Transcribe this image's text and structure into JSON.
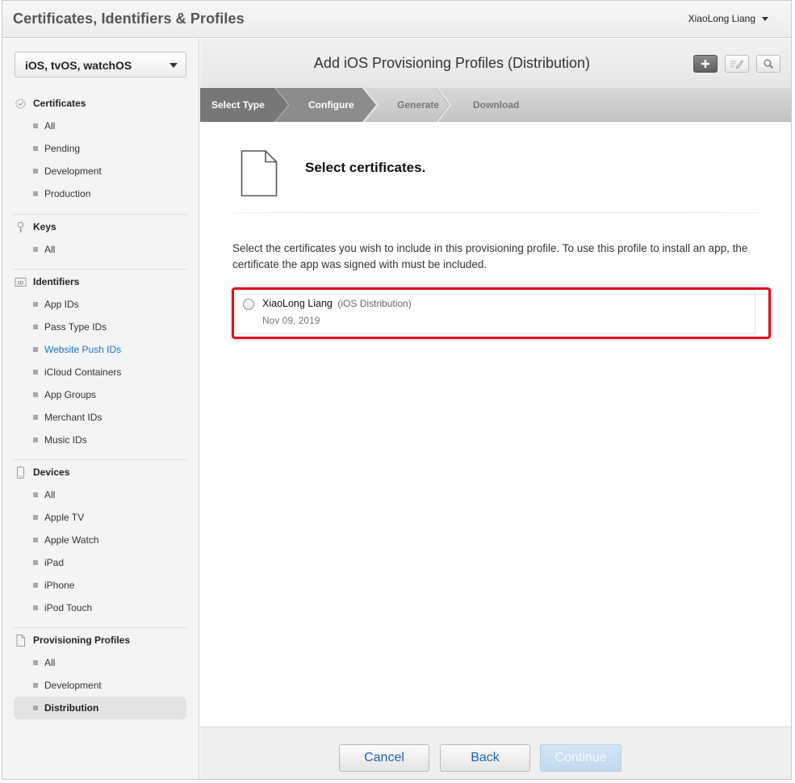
{
  "app": {
    "title": "Certificates, Identifiers & Profiles",
    "user_name": "XiaoLong Liang"
  },
  "sidebar": {
    "platform": "iOS, tvOS, watchOS",
    "sections": [
      {
        "title": "Certificates",
        "icon": "certificate-icon",
        "items": [
          "All",
          "Pending",
          "Development",
          "Production"
        ]
      },
      {
        "title": "Keys",
        "icon": "key-icon",
        "items": [
          "All"
        ]
      },
      {
        "title": "Identifiers",
        "icon": "id-icon",
        "items": [
          "App IDs",
          "Pass Type IDs",
          "Website Push IDs",
          "iCloud Containers",
          "App Groups",
          "Merchant IDs",
          "Music IDs"
        ]
      },
      {
        "title": "Devices",
        "icon": "device-icon",
        "items": [
          "All",
          "Apple TV",
          "Apple Watch",
          "iPad",
          "iPhone",
          "iPod Touch"
        ]
      },
      {
        "title": "Provisioning Profiles",
        "icon": "document-icon",
        "items": [
          "All",
          "Development",
          "Distribution"
        ]
      }
    ],
    "highlighted_link": "Website Push IDs",
    "active_item": "Distribution"
  },
  "main": {
    "title": "Add iOS Provisioning Profiles (Distribution)",
    "toolbar_icons": [
      "plus-icon",
      "edit-icon",
      "search-icon"
    ],
    "steps": [
      "Select Type",
      "Configure",
      "Generate",
      "Download"
    ],
    "content_title": "Select certificates.",
    "description": "Select the certificates you wish to include in this provisioning profile. To use this profile to install an app, the certificate the app was signed with must be included.",
    "certificate": {
      "name": "XiaoLong Liang",
      "type": "(iOS Distribution)",
      "date": "Nov 09, 2019",
      "selected": false
    }
  },
  "footer": {
    "cancel_label": "Cancel",
    "back_label": "Back",
    "continue_label": "Continue"
  },
  "colors": {
    "link": "#1b73c2",
    "highlight_border": "#e0101a",
    "step_done": "#7a7a7a",
    "step_current": "#8c8c8c",
    "button_text": "#1a64b4",
    "continue_disabled": "#c9ddf1"
  }
}
